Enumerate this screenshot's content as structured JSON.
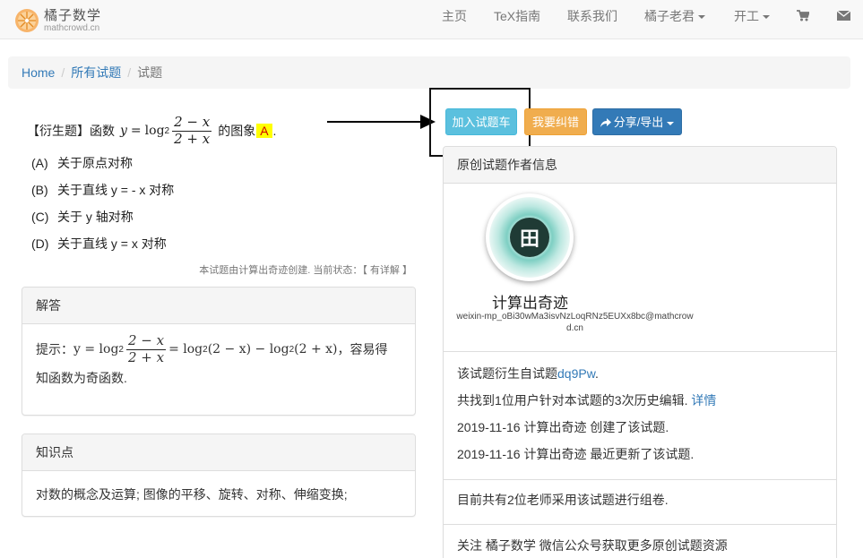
{
  "navbar": {
    "brand_name": "橘子数学",
    "brand_domain": "mathcrowd.cn",
    "items": [
      {
        "label": "主页"
      },
      {
        "label": "TeX指南"
      },
      {
        "label": "联系我们"
      },
      {
        "label": "橘子老君"
      },
      {
        "label": "开工"
      }
    ],
    "cart_icon": "cart-icon",
    "mail_icon": "envelope-icon"
  },
  "breadcrumb": {
    "items": [
      "Home",
      "所有试题",
      "试题"
    ]
  },
  "question": {
    "prefix": "【衍生题】函数",
    "math_y": "y",
    "math_log": "log",
    "math_base": "2",
    "frac_num": "2 − x",
    "frac_den": "2 + x",
    "suffix": "的图象",
    "answer_mark": "A",
    "end": ".",
    "options": [
      {
        "key": "(A)",
        "text": "关于原点对称"
      },
      {
        "key": "(B)",
        "text": "关于直线 y = - x 对称"
      },
      {
        "key": "(C)",
        "text": "关于 y 轴对称"
      },
      {
        "key": "(D)",
        "text": "关于直线 y = x 对称"
      }
    ],
    "status_line": "本试题由计算出奇迹创建. 当前状态：【 有详解 】"
  },
  "solution": {
    "heading": "解答",
    "prefix": "提示：",
    "math_lhs": "y = log",
    "base": "2",
    "frac_num": "2 − x",
    "frac_den": "2 + x",
    "math_rhs_1": "= log",
    "base_2": "2",
    "math_rhs_2": "(2 − x) − log",
    "base_3": "2",
    "math_rhs_3": "(2 + x)",
    "tail": "，容易得",
    "line2": "知函数为奇函数."
  },
  "knowledge": {
    "heading": "知识点",
    "text": "对数的概念及运算; 图像的平移、旋转、对称、伸缩变换;"
  },
  "actions": {
    "add_to_cart": "加入试题车",
    "report_error": "我要纠错",
    "share_export": "分享/导出",
    "share_icon": "share-icon"
  },
  "author_panel": {
    "heading": "原创试题作者信息",
    "avatar_glyph": "田",
    "name": "计算出奇迹",
    "email": "weixin-mp_oBi30wMa3isvNzLoqRNz5EUXx8bc@mathcrowd.cn",
    "derived_prefix": "该试题衍生自试题",
    "derived_link": "dq9Pw",
    "derived_suffix": ".",
    "history_text": "共找到1位用户针对本试题的3次历史编辑.",
    "history_link": "详情",
    "created": "2019-11-16 计算出奇迹 创建了该试题.",
    "updated": "2019-11-16 计算出奇迹 最近更新了该试题.",
    "usage": "目前共有2位老师采用该试题进行组卷.",
    "follow": "关注 橘子数学 微信公众号获取更多原创试题资源"
  },
  "colors": {
    "btn_info": "#5bc0de",
    "btn_warning": "#f0ad4e",
    "btn_primary": "#337ab7",
    "link": "#337ab7",
    "answer_highlight": "#ffff00"
  }
}
